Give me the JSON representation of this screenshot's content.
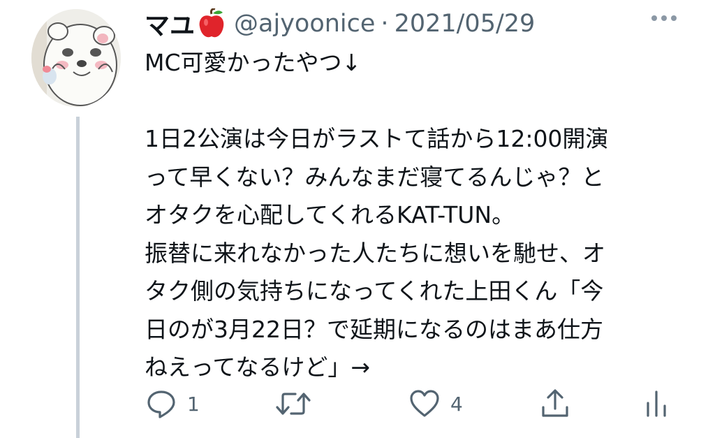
{
  "tweet": {
    "author_name": "マユ",
    "author_emoji": "apple-icon",
    "handle": "@ajyoonice",
    "separator": "·",
    "date": "2021/05/29",
    "lines": [
      "MC可愛かったやつ↓",
      "",
      "1日2公演は今日がラストて話から12:00開演",
      "って早くない？みんなまだ寝てるんじゃ？と",
      "オタクを心配してくれるKAT-TUN。",
      "振替に来れなかった人たちに想いを馳せ、オ",
      "タク側の気持ちになってくれた上田くん「今",
      "日のが3月22日？で延期になるのはまあ仕方",
      "ねえってなるけど」→"
    ]
  },
  "actions": {
    "reply_count": "1",
    "retweet_count": "",
    "like_count": "4"
  },
  "icons": {
    "reply": "reply-icon",
    "retweet": "retweet-icon",
    "like": "heart-icon",
    "share": "share-icon",
    "analytics": "analytics-icon",
    "more": "more-icon"
  },
  "colors": {
    "text": "#0f1419",
    "secondary": "#536471",
    "icon": "#536471",
    "thread_line": "#c9d1d9"
  }
}
